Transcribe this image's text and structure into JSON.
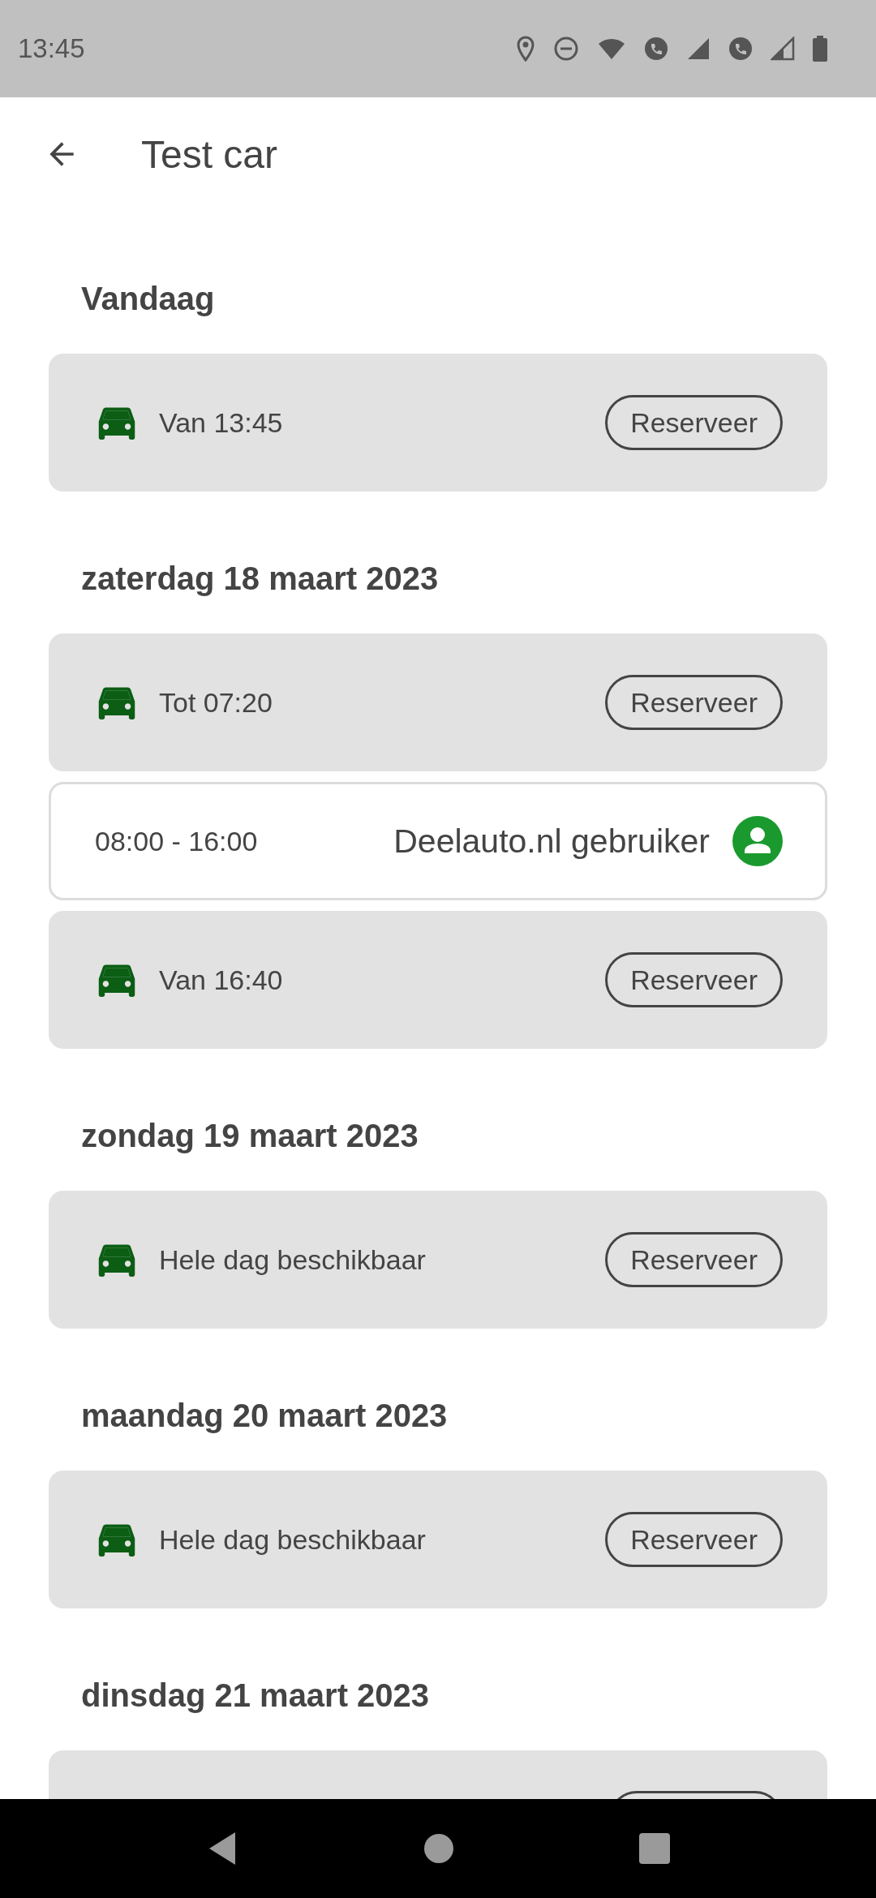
{
  "status_bar": {
    "time": "13:45"
  },
  "app_bar": {
    "title": "Test car"
  },
  "days": [
    {
      "heading": "Vandaag",
      "slots": [
        {
          "kind": "free",
          "text": "Van 13:45",
          "button": "Reserveer"
        }
      ]
    },
    {
      "heading": "zaterdag 18 maart 2023",
      "slots": [
        {
          "kind": "free",
          "text": "Tot 07:20",
          "button": "Reserveer"
        },
        {
          "kind": "booked",
          "time": "08:00 - 16:00",
          "user": "Deelauto.nl gebruiker"
        },
        {
          "kind": "free",
          "text": "Van 16:40",
          "button": "Reserveer"
        }
      ]
    },
    {
      "heading": "zondag 19 maart 2023",
      "slots": [
        {
          "kind": "free",
          "text": "Hele dag beschikbaar",
          "button": "Reserveer"
        }
      ]
    },
    {
      "heading": "maandag 20 maart 2023",
      "slots": [
        {
          "kind": "free",
          "text": "Hele dag beschikbaar",
          "button": "Reserveer"
        }
      ]
    },
    {
      "heading": "dinsdag 21 maart 2023",
      "slots": [
        {
          "kind": "partial"
        }
      ]
    }
  ]
}
